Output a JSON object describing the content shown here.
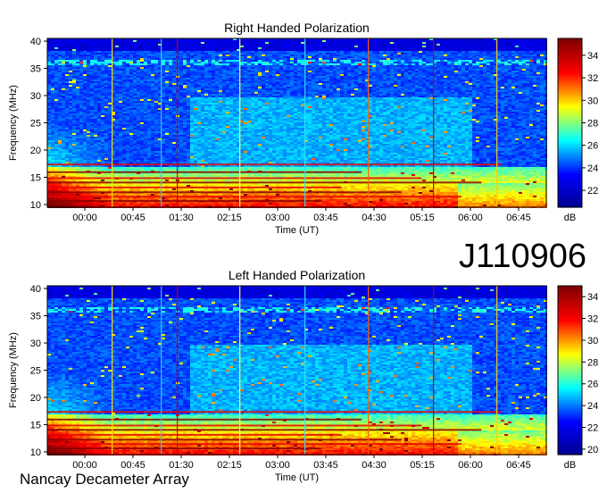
{
  "observation_id": "J110906",
  "footer": "Nancay Decameter Array",
  "chart_data": [
    {
      "type": "heatmap",
      "title": "Right Handed Polarization",
      "xlabel": "Time (UT)",
      "ylabel": "Frequency (MHz)",
      "x_ticks": [
        "00:00",
        "00:45",
        "01:30",
        "02:15",
        "03:00",
        "03:45",
        "04:30",
        "05:15",
        "06:00",
        "06:45"
      ],
      "y_ticks": [
        10,
        15,
        20,
        25,
        30,
        35,
        40
      ],
      "ylim": [
        9.5,
        40.5
      ],
      "colorbar": {
        "label": "dB",
        "ticks": [
          22,
          24,
          26,
          28,
          30,
          32,
          34
        ],
        "range": [
          20.5,
          35.5
        ]
      },
      "colormap": [
        "#00008f",
        "#0000ff",
        "#00ffff",
        "#ffff00",
        "#ff0000",
        "#800000"
      ]
    },
    {
      "type": "heatmap",
      "title": "Left Handed Polarization",
      "xlabel": "Time (UT)",
      "ylabel": "Frequency (MHz)",
      "x_ticks": [
        "00:00",
        "00:45",
        "01:30",
        "02:15",
        "03:00",
        "03:45",
        "04:30",
        "05:15",
        "06:00",
        "06:45"
      ],
      "y_ticks": [
        10,
        15,
        20,
        25,
        30,
        35,
        40
      ],
      "ylim": [
        9.5,
        40.5
      ],
      "colorbar": {
        "label": "dB",
        "ticks": [
          20,
          22,
          24,
          26,
          28,
          30,
          32,
          34
        ],
        "range": [
          19.5,
          35.0
        ]
      },
      "colormap": [
        "#00008f",
        "#0000ff",
        "#00ffff",
        "#ffff00",
        "#ff0000",
        "#800000"
      ]
    }
  ]
}
